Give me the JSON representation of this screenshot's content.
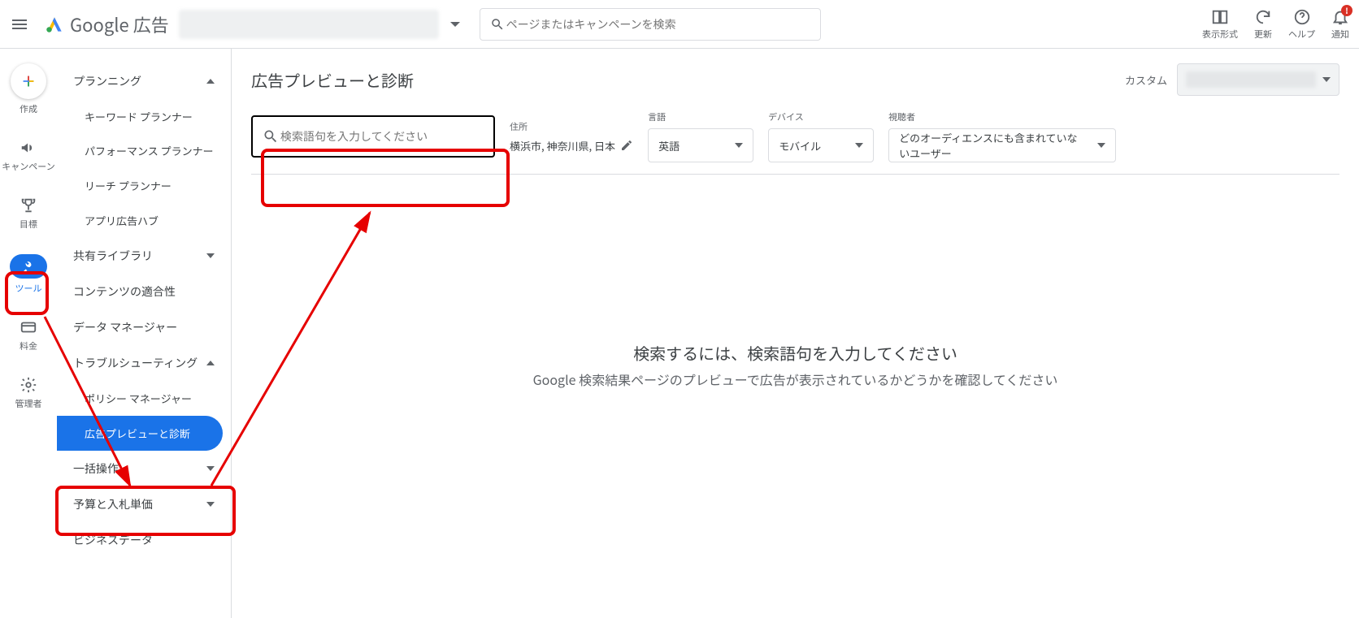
{
  "header": {
    "product": "Google 広告",
    "search_placeholder": "ページまたはキャンペーンを検索",
    "tools": {
      "display": "表示形式",
      "refresh": "更新",
      "help": "ヘルプ",
      "notifications": "通知",
      "notification_badge": "!"
    }
  },
  "rail": {
    "create": "作成",
    "campaigns": "キャンペーン",
    "goals": "目標",
    "tools": "ツール",
    "billing": "料金",
    "admin": "管理者"
  },
  "sidebar": {
    "planning": "プランニング",
    "planning_items": {
      "keyword_planner": "キーワード プランナー",
      "performance_planner": "パフォーマンス プランナー",
      "reach_planner": "リーチ プランナー",
      "app_hub": "アプリ広告ハブ"
    },
    "shared_library": "共有ライブラリ",
    "content_suitability": "コンテンツの適合性",
    "data_manager": "データ マネージャー",
    "troubleshooting": "トラブルシューティング",
    "troubleshooting_items": {
      "policy_manager": "ポリシー マネージャー",
      "ad_preview": "広告プレビューと診断"
    },
    "bulk_actions": "一括操作",
    "budgets": "予算と入札単価",
    "business_data": "ビジネスデータ"
  },
  "main": {
    "title": "広告プレビューと診断",
    "custom_label": "カスタム",
    "search_placeholder": "検索語句を入力してください",
    "location": {
      "label": "住所",
      "value": "横浜市, 神奈川県, 日本"
    },
    "language": {
      "label": "言語",
      "value": "英語"
    },
    "device": {
      "label": "デバイス",
      "value": "モバイル"
    },
    "audience": {
      "label": "視聴者",
      "value": "どのオーディエンスにも含まれていないユーザー"
    },
    "empty1": "検索するには、検索語句を入力してください",
    "empty2": "Google 検索結果ページのプレビューで広告が表示されているかどうかを確認してください"
  }
}
